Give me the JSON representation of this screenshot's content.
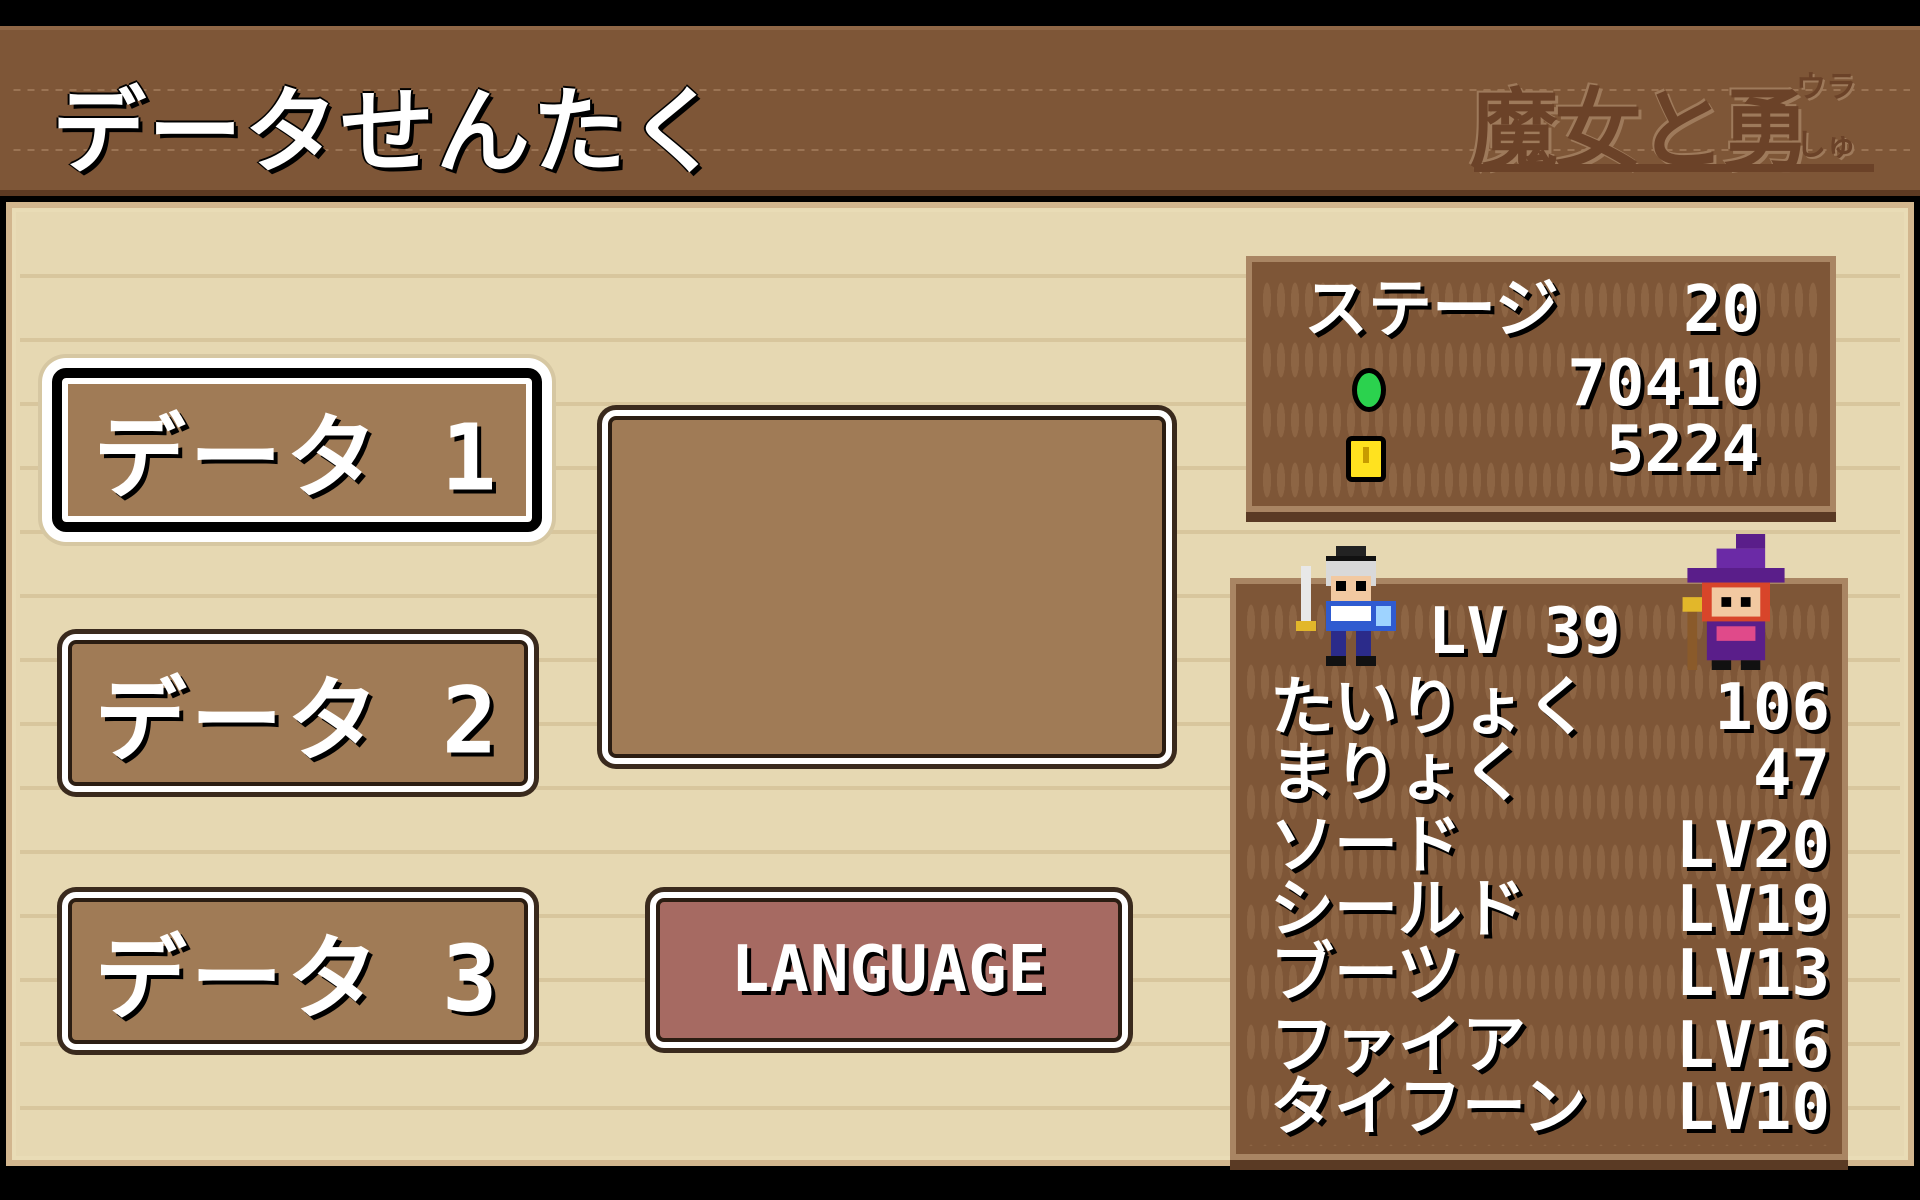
{
  "header": {
    "title": "データせんたく",
    "logo": {
      "main": "魔女と勇者",
      "sub1": "ウラ",
      "sub2": "しゅ"
    }
  },
  "slots": [
    {
      "label": "データ 1",
      "selected": true
    },
    {
      "label": "データ 2",
      "selected": false
    },
    {
      "label": "データ 3",
      "selected": false
    }
  ],
  "language_button": "LANGUAGE",
  "summary": {
    "stage_label": "ステージ",
    "stage_value": "20",
    "gems": "70410",
    "coins": "5224",
    "gem_color": "#2bd24e",
    "coin_color": "#ffe21f"
  },
  "party": {
    "level": "LV 39",
    "stats": [
      {
        "label": "たいりょく",
        "value": "106"
      },
      {
        "label": "まりょく",
        "value": "47"
      },
      {
        "label": "ソード",
        "value": "LV20"
      },
      {
        "label": "シールド",
        "value": "LV19"
      },
      {
        "label": "ブーツ",
        "value": "LV13"
      },
      {
        "label": "ファイア",
        "value": "LV16"
      },
      {
        "label": "タイフーン",
        "value": "LV10"
      }
    ]
  },
  "colors": {
    "wood": "#7e5637",
    "panel_bg": "#e6d8b2",
    "button": "#a07b56",
    "language_button": "#a66a62"
  }
}
